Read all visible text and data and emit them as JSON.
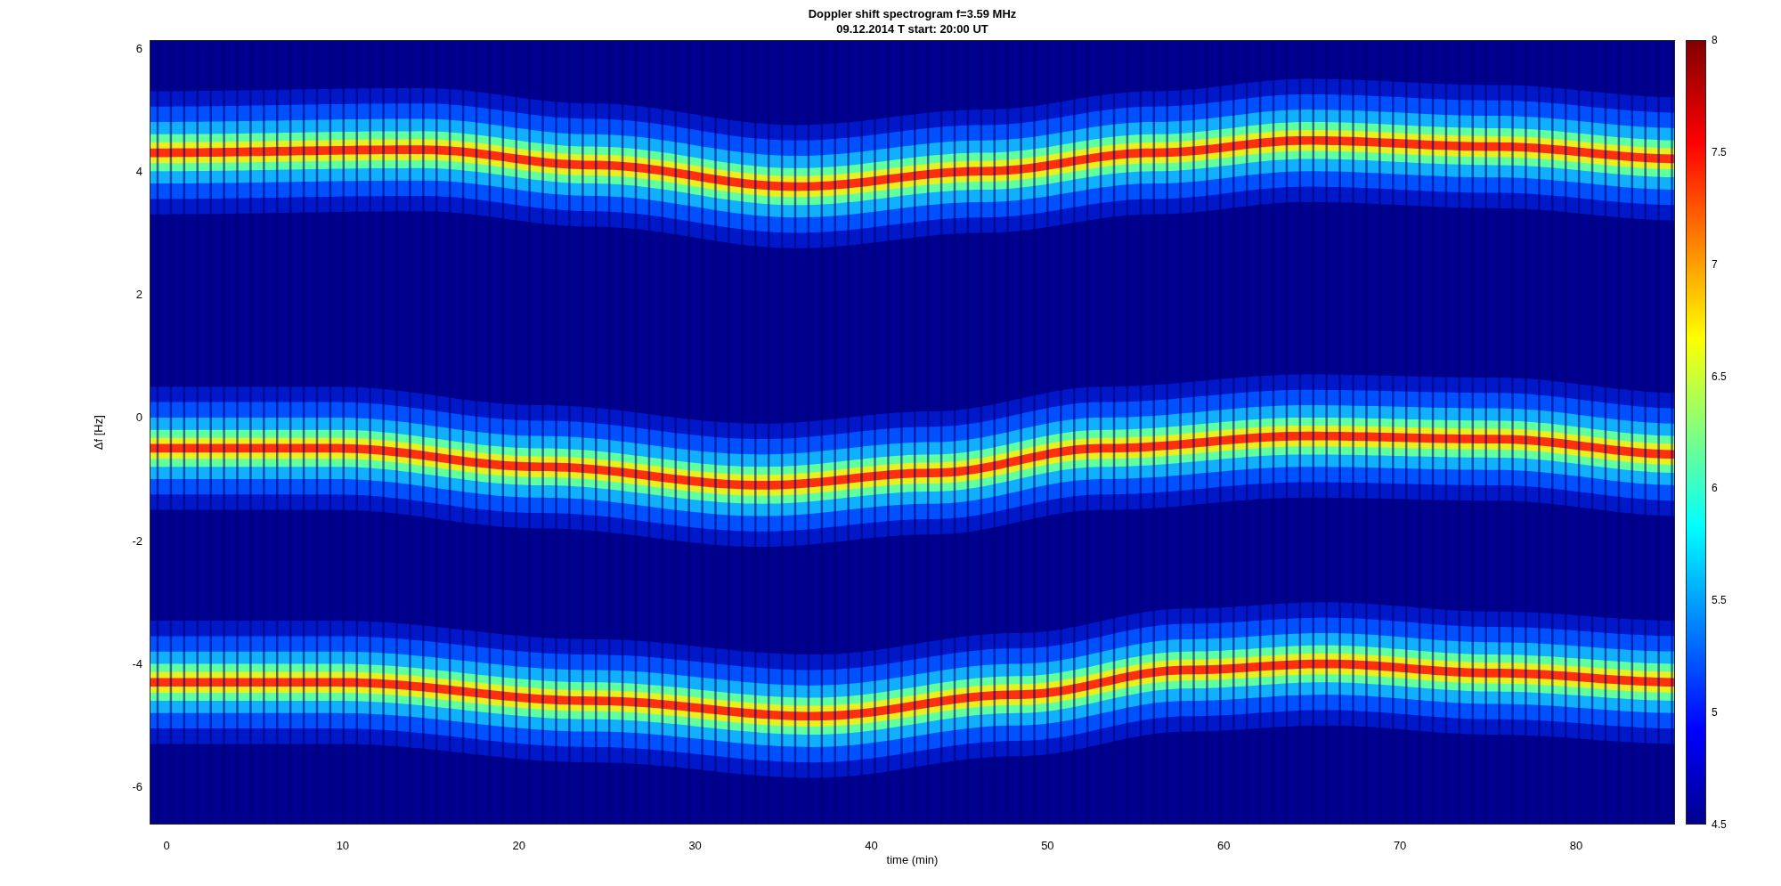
{
  "title": {
    "lines": [
      "Doppler shift spectrogram f=3.59 MHz",
      "09.12.2014   T start: 20:00 UT"
    ]
  },
  "y_axis": {
    "label": "Δf [Hz]",
    "ticks": [
      "6",
      "4",
      "2",
      "0",
      "-2",
      "-4",
      "-6"
    ]
  },
  "x_axis": {
    "label": "time (min)",
    "ticks": [
      "0",
      "10",
      "20",
      "30",
      "40",
      "50",
      "60",
      "70",
      "80"
    ]
  },
  "colorbar": {
    "ticks": [
      "8",
      "7.5",
      "7",
      "6.5",
      "6",
      "5.5",
      "5",
      "4.5"
    ]
  }
}
